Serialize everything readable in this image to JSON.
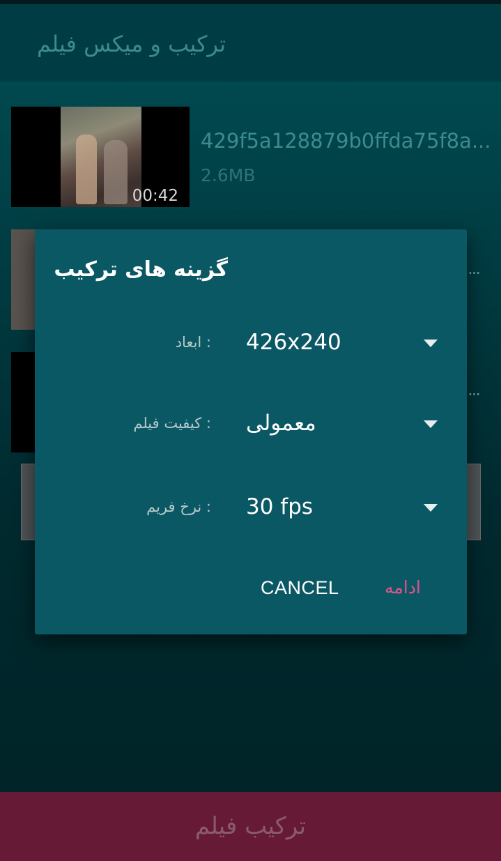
{
  "app_bar": {
    "title": "ترکیب و میکس فیلم"
  },
  "videos": [
    {
      "name": "429f5a128879b0ffda75f8a...",
      "size": "2.6MB",
      "duration": "00:42"
    },
    {
      "more": "..."
    },
    {
      "more": "..."
    }
  ],
  "bottom_bar": {
    "label": "ترکیب فیلم"
  },
  "dialog": {
    "title": "گزینه های ترکیب",
    "options": [
      {
        "label": ": ابعاد",
        "value": "426x240"
      },
      {
        "label": ": کیفیت فیلم",
        "value": "معمولی"
      },
      {
        "label": ": نرخ فریم",
        "value": "30 fps"
      }
    ],
    "cancel_label": "CANCEL",
    "continue_label": "ادامه"
  },
  "colors": {
    "dialog_bg": "#0b5865",
    "accent": "#e0538a",
    "bottom_bar": "#661a35"
  }
}
